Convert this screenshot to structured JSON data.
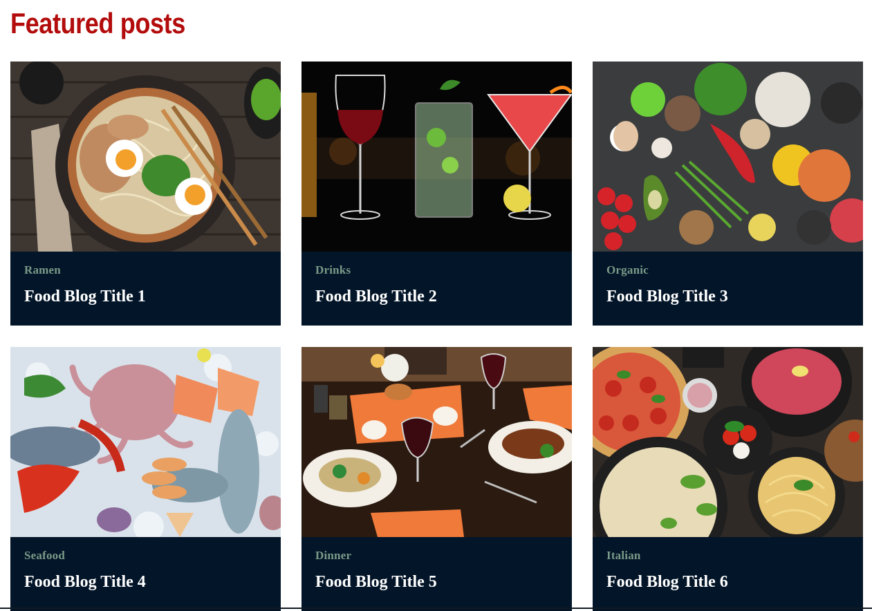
{
  "section": {
    "title": "Featured posts"
  },
  "posts": [
    {
      "category": "Ramen",
      "title": "Food Blog Title 1",
      "image": "ramen-bowl-photo"
    },
    {
      "category": "Drinks",
      "title": "Food Blog Title 2",
      "image": "cocktails-photo"
    },
    {
      "category": "Organic",
      "title": "Food Blog Title 3",
      "image": "organic-vegetables-photo"
    },
    {
      "category": "Seafood",
      "title": "Food Blog Title 4",
      "image": "seafood-on-ice-photo"
    },
    {
      "category": "Dinner",
      "title": "Food Blog Title 5",
      "image": "dinner-table-photo"
    },
    {
      "category": "Italian",
      "title": "Food Blog Title 6",
      "image": "italian-dishes-photo"
    }
  ],
  "colors": {
    "heading": "#b30c0c",
    "card_background": "#031528",
    "category_text": "#7a9a88",
    "title_text": "#ffffff"
  }
}
